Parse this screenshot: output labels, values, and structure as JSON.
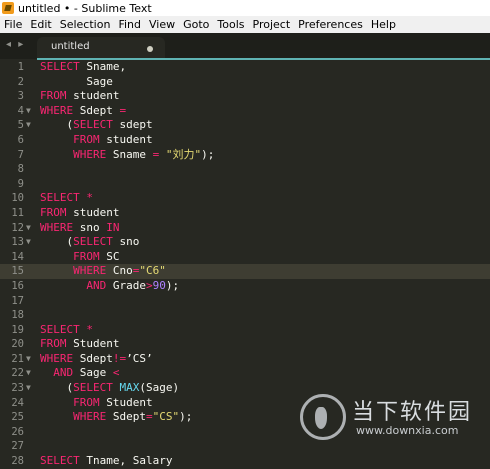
{
  "window": {
    "title": "untitled • - Sublime Text"
  },
  "menu": [
    "File",
    "Edit",
    "Selection",
    "Find",
    "View",
    "Goto",
    "Tools",
    "Project",
    "Preferences",
    "Help"
  ],
  "tabs": {
    "nav_arrows": "◂ ▸",
    "active_label": "untitled"
  },
  "editor": {
    "highlighted_line": 15,
    "lines": [
      {
        "n": "1",
        "fold": "",
        "tokens": [
          {
            "c": "kw",
            "t": "SELECT"
          },
          {
            "c": "pl",
            "t": " Sname,"
          }
        ]
      },
      {
        "n": "2",
        "fold": "",
        "tokens": [
          {
            "c": "pl",
            "t": "       Sage"
          }
        ]
      },
      {
        "n": "3",
        "fold": "",
        "tokens": [
          {
            "c": "kw",
            "t": "FROM"
          },
          {
            "c": "pl",
            "t": " student"
          }
        ]
      },
      {
        "n": "4",
        "fold": "▼",
        "tokens": [
          {
            "c": "kw",
            "t": "WHERE"
          },
          {
            "c": "pl",
            "t": " Sdept "
          },
          {
            "c": "kw",
            "t": "="
          }
        ]
      },
      {
        "n": "5",
        "fold": "▼",
        "tokens": [
          {
            "c": "pl",
            "t": "    ("
          },
          {
            "c": "kw",
            "t": "SELECT"
          },
          {
            "c": "pl",
            "t": " sdept"
          }
        ]
      },
      {
        "n": "6",
        "fold": "",
        "tokens": [
          {
            "c": "pl",
            "t": "     "
          },
          {
            "c": "kw",
            "t": "FROM"
          },
          {
            "c": "pl",
            "t": " student"
          }
        ]
      },
      {
        "n": "7",
        "fold": "",
        "tokens": [
          {
            "c": "pl",
            "t": "     "
          },
          {
            "c": "kw",
            "t": "WHERE"
          },
          {
            "c": "pl",
            "t": " Sname "
          },
          {
            "c": "kw",
            "t": "="
          },
          {
            "c": "pl",
            "t": " "
          },
          {
            "c": "str",
            "t": "\"刘力\""
          },
          {
            "c": "pl",
            "t": ");"
          }
        ]
      },
      {
        "n": "8",
        "fold": "",
        "tokens": []
      },
      {
        "n": "9",
        "fold": "",
        "tokens": []
      },
      {
        "n": "10",
        "fold": "",
        "tokens": [
          {
            "c": "kw",
            "t": "SELECT"
          },
          {
            "c": "pl",
            "t": " "
          },
          {
            "c": "kw",
            "t": "*"
          }
        ]
      },
      {
        "n": "11",
        "fold": "",
        "tokens": [
          {
            "c": "kw",
            "t": "FROM"
          },
          {
            "c": "pl",
            "t": " student"
          }
        ]
      },
      {
        "n": "12",
        "fold": "▼",
        "tokens": [
          {
            "c": "kw",
            "t": "WHERE"
          },
          {
            "c": "pl",
            "t": " sno "
          },
          {
            "c": "kw",
            "t": "IN"
          }
        ]
      },
      {
        "n": "13",
        "fold": "▼",
        "tokens": [
          {
            "c": "pl",
            "t": "    ("
          },
          {
            "c": "kw",
            "t": "SELECT"
          },
          {
            "c": "pl",
            "t": " sno"
          }
        ]
      },
      {
        "n": "14",
        "fold": "",
        "tokens": [
          {
            "c": "pl",
            "t": "     "
          },
          {
            "c": "kw",
            "t": "FROM"
          },
          {
            "c": "pl",
            "t": " SC"
          }
        ]
      },
      {
        "n": "15",
        "fold": "",
        "tokens": [
          {
            "c": "pl",
            "t": "     "
          },
          {
            "c": "kw",
            "t": "WHERE"
          },
          {
            "c": "pl",
            "t": " Cno"
          },
          {
            "c": "kw",
            "t": "="
          },
          {
            "c": "str",
            "t": "\"C6\""
          }
        ]
      },
      {
        "n": "16",
        "fold": "",
        "tokens": [
          {
            "c": "pl",
            "t": "       "
          },
          {
            "c": "kw",
            "t": "AND"
          },
          {
            "c": "pl",
            "t": " Grade"
          },
          {
            "c": "kw",
            "t": ">"
          },
          {
            "c": "num",
            "t": "90"
          },
          {
            "c": "pl",
            "t": ");"
          }
        ]
      },
      {
        "n": "17",
        "fold": "",
        "tokens": []
      },
      {
        "n": "18",
        "fold": "",
        "tokens": []
      },
      {
        "n": "19",
        "fold": "",
        "tokens": [
          {
            "c": "kw",
            "t": "SELECT"
          },
          {
            "c": "pl",
            "t": " "
          },
          {
            "c": "kw",
            "t": "*"
          }
        ]
      },
      {
        "n": "20",
        "fold": "",
        "tokens": [
          {
            "c": "kw",
            "t": "FROM"
          },
          {
            "c": "pl",
            "t": " Student"
          }
        ]
      },
      {
        "n": "21",
        "fold": "▼",
        "tokens": [
          {
            "c": "kw",
            "t": "WHERE"
          },
          {
            "c": "pl",
            "t": " Sdept"
          },
          {
            "c": "kw",
            "t": "!="
          },
          {
            "c": "pl",
            "t": "’CS’"
          }
        ]
      },
      {
        "n": "22",
        "fold": "▼",
        "tokens": [
          {
            "c": "pl",
            "t": "  "
          },
          {
            "c": "kw",
            "t": "AND"
          },
          {
            "c": "pl",
            "t": " Sage "
          },
          {
            "c": "kw",
            "t": "<"
          }
        ]
      },
      {
        "n": "23",
        "fold": "▼",
        "tokens": [
          {
            "c": "pl",
            "t": "    ("
          },
          {
            "c": "kw",
            "t": "SELECT"
          },
          {
            "c": "pl",
            "t": " "
          },
          {
            "c": "fn",
            "t": "MAX"
          },
          {
            "c": "pl",
            "t": "(Sage)"
          }
        ]
      },
      {
        "n": "24",
        "fold": "",
        "tokens": [
          {
            "c": "pl",
            "t": "     "
          },
          {
            "c": "kw",
            "t": "FROM"
          },
          {
            "c": "pl",
            "t": " Student"
          }
        ]
      },
      {
        "n": "25",
        "fold": "",
        "tokens": [
          {
            "c": "pl",
            "t": "     "
          },
          {
            "c": "kw",
            "t": "WHERE"
          },
          {
            "c": "pl",
            "t": " Sdept"
          },
          {
            "c": "kw",
            "t": "="
          },
          {
            "c": "str",
            "t": "\"CS\""
          },
          {
            "c": "pl",
            "t": ");"
          }
        ]
      },
      {
        "n": "26",
        "fold": "",
        "tokens": []
      },
      {
        "n": "27",
        "fold": "",
        "tokens": []
      },
      {
        "n": "28",
        "fold": "",
        "tokens": [
          {
            "c": "kw",
            "t": "SELECT"
          },
          {
            "c": "pl",
            "t": " Tname, Salary"
          }
        ]
      }
    ]
  },
  "watermark": {
    "cn": "当下软件园",
    "url": "www.downxia.com"
  },
  "colors": {
    "background": "#272822",
    "keyword": "#f92672",
    "string": "#e6db74",
    "number": "#ae81ff",
    "function": "#66d9ef",
    "accent": "#5fb3b3"
  }
}
